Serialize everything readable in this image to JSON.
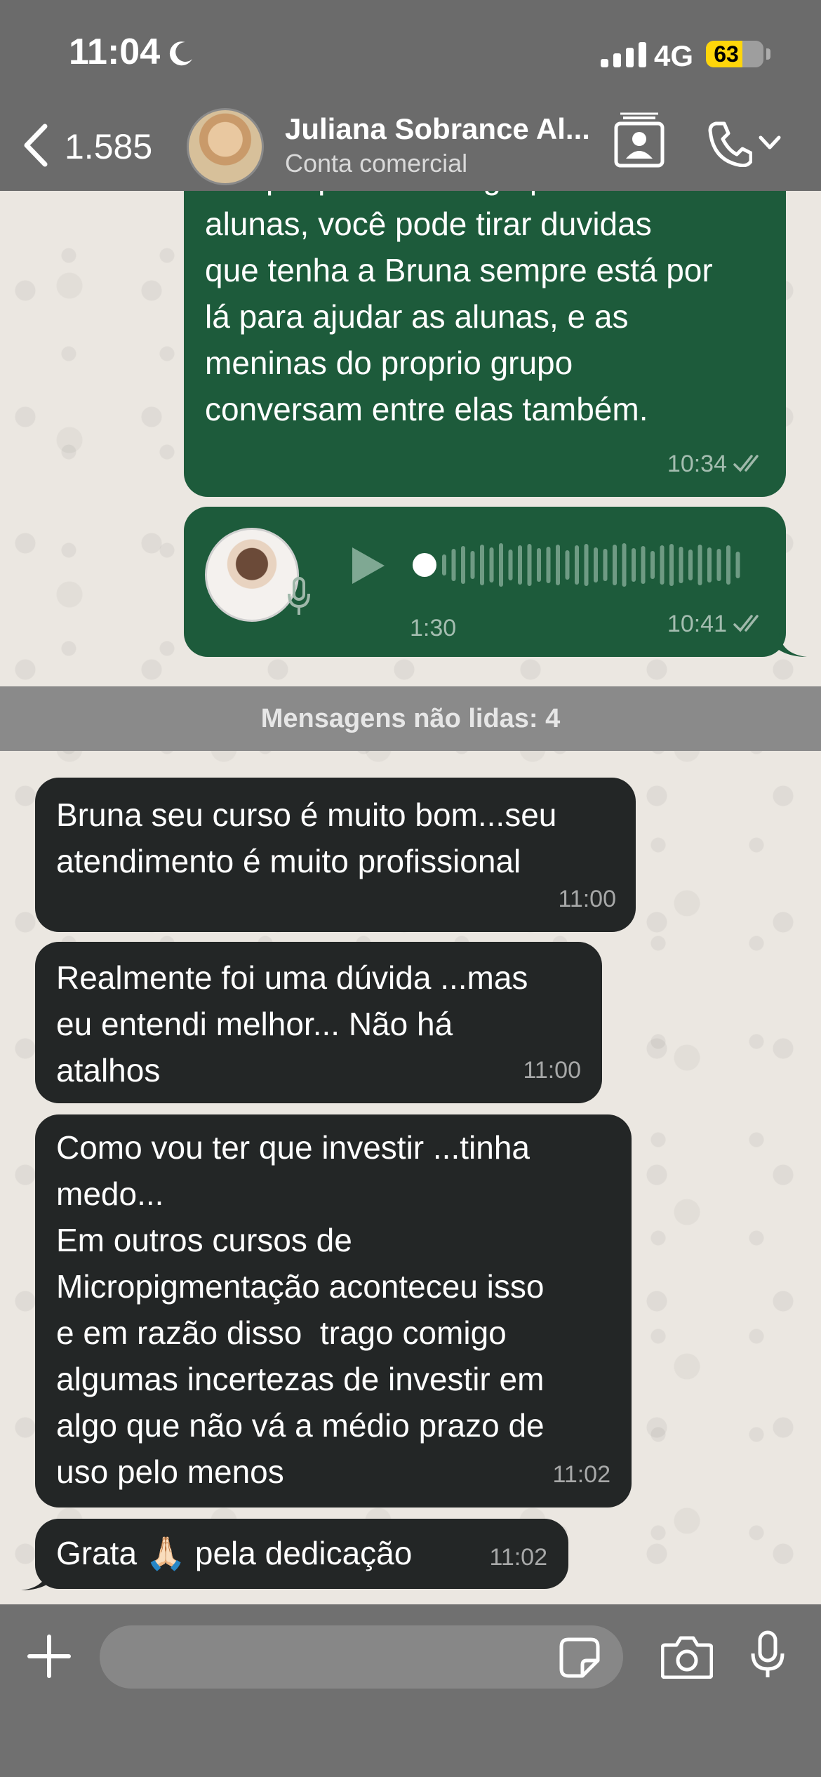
{
  "status_bar": {
    "time": "11:04",
    "network": "4G",
    "battery": "63",
    "battery_level": 0.63
  },
  "header": {
    "back_count": "1.585",
    "contact_name": "Juliana Sobrance Al...",
    "contact_subtitle": "Conta comercial",
    "icons": [
      "chevron-left-icon",
      "contact-card-icon",
      "phone-icon",
      "chevron-down-icon"
    ]
  },
  "messages": {
    "m1": {
      "text": "Porque pelo nosso grupo de\nalunas, você pode tirar duvidas\nque tenha a Bruna sempre está por\nlá para ajudar as alunas, e as\nmeninas do proprio grupo\nconversam entre elas também.",
      "time": "10:34"
    },
    "m2": {
      "type": "voice",
      "duration": "1:30",
      "time": "10:41"
    },
    "unread_divider": "Mensagens não lidas: 4",
    "m3": {
      "text": "Bruna seu curso é muito bom...seu\natendimento é muito profissional",
      "time": "11:00"
    },
    "m4": {
      "text": "Realmente foi uma dúvida ...mas\neu entendi melhor... Não há\natalhos",
      "time": "11:00"
    },
    "m5": {
      "text": "Como vou ter que investir ...tinha\nmedo...\nEm outros cursos de\nMicropigmentação aconteceu isso\ne em razão disso  trago comigo\nalgumas incertezas de investir em\nalgo que não vá a médio prazo de\nuso pelo menos",
      "time": "11:02"
    },
    "m6": {
      "text": "Grata 🙏🏻 pela dedicação",
      "time": "11:02"
    }
  },
  "input_bar": {
    "placeholder": "",
    "icons": [
      "plus-icon",
      "sticker-icon",
      "camera-icon",
      "microphone-icon"
    ]
  },
  "colors": {
    "outgoing_bubble": "#1d5b3b",
    "incoming_bubble": "#232626",
    "read_ticks": "#9fb8aa",
    "battery_fill": "#ffd60a"
  }
}
